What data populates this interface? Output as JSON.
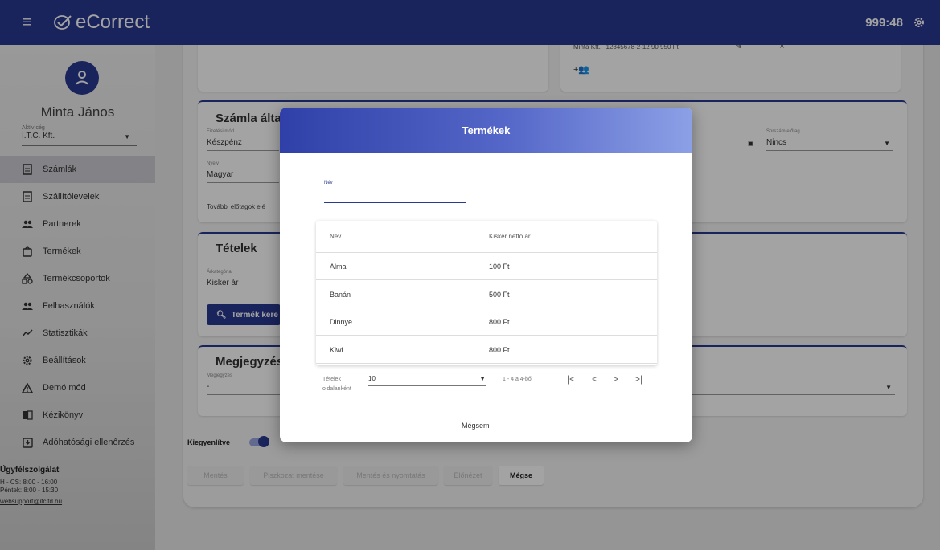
{
  "app": {
    "logo_text": "eCorrect",
    "timer": "999:48"
  },
  "sidebar": {
    "user_name": "Minta János",
    "company_label": "Aktív cég",
    "company_value": "I.T.C. Kft.",
    "items": [
      {
        "label": "Számlák",
        "icon": "invoice-icon"
      },
      {
        "label": "Szállítólevelek",
        "icon": "document-icon"
      },
      {
        "label": "Partnerek",
        "icon": "people-icon"
      },
      {
        "label": "Termékek",
        "icon": "bag-icon"
      },
      {
        "label": "Termékcsoportok",
        "icon": "shapes-icon"
      },
      {
        "label": "Felhasználók",
        "icon": "people-icon"
      },
      {
        "label": "Statisztikák",
        "icon": "chart-line-icon"
      },
      {
        "label": "Beállítások",
        "icon": "gear-icon"
      },
      {
        "label": "Demó mód",
        "icon": "warning-icon"
      },
      {
        "label": "Kézikönyv",
        "icon": "book-icon"
      },
      {
        "label": "Adóhatósági ellenőrzés",
        "icon": "download-box-icon"
      }
    ],
    "support": {
      "title": "Ügyfélszolgálat",
      "hours_weekdays": "H - CS: 8:00 - 16:00",
      "hours_friday": "Péntek: 8:00 - 15:30",
      "email": "websupport@itcltd.hu"
    }
  },
  "main": {
    "partner_line": "Minta Kft.   12345678-2-12 90 950 Ft",
    "invoice_card": {
      "title": "Számla által",
      "payment_label": "Fizetési mód",
      "payment_value": "Készpénz",
      "language_label": "Nyelv",
      "language_value": "Magyar",
      "more_prefixes": "További előtagok elé",
      "serial_label": "Sorszám előtag",
      "serial_value": "Nincs"
    },
    "items_card": {
      "title": "Tételek",
      "price_category_label": "Árkategória",
      "price_category_value": "Kisker ár",
      "search_button": "Termék kere"
    },
    "notes_card": {
      "title": "Megjegyzés",
      "notes_label": "Megjegyzés",
      "notes_value": "-"
    },
    "settled_label": "Kiegyenlítve",
    "actions": {
      "save": "Mentés",
      "save_draft": "Piszkozat mentése",
      "save_print": "Mentés és nyomtatás",
      "preview": "Előnézet",
      "cancel": "Mégse"
    }
  },
  "modal": {
    "title": "Termékek",
    "name_label": "Név",
    "name_value": "",
    "columns": {
      "name": "Név",
      "price": "Kisker nettó ár"
    },
    "rows": [
      {
        "name": "Alma",
        "price": "100 Ft"
      },
      {
        "name": "Banán",
        "price": "500 Ft"
      },
      {
        "name": "Dinnye",
        "price": "800 Ft"
      },
      {
        "name": "Kiwi",
        "price": "800 Ft"
      }
    ],
    "pager": {
      "label_line1": "Tételek",
      "label_line2": "oldalanként",
      "per_page": "10",
      "range": "1 - 4 a 4-ből",
      "first": "|<",
      "prev": "<",
      "next": ">",
      "last": ">|"
    },
    "cancel": "Mégsem"
  },
  "colors": {
    "primary": "#2a3990"
  }
}
